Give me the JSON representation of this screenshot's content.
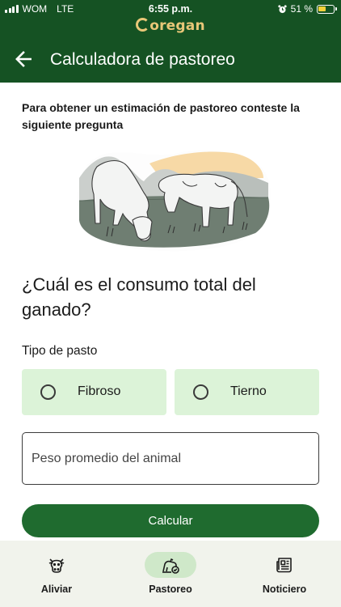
{
  "status_bar": {
    "carrier": "WOM",
    "network": "LTE",
    "time": "6:55 p.m.",
    "battery": "51 %",
    "battery_level": 0.51
  },
  "brand": {
    "logo_text": "oregan"
  },
  "header": {
    "title": "Calculadora de pastoreo"
  },
  "intro_text": "Para obtener un estimación de pastoreo conteste la siguiente pregunta",
  "question": "¿Cuál es el consumo total del ganado?",
  "pasture": {
    "label": "Tipo de pasto",
    "options": [
      "Fibroso",
      "Tierno"
    ]
  },
  "weight_field": {
    "placeholder": "Peso promedio del animal"
  },
  "calculate_button": "Calcular",
  "bottom_nav": {
    "items": [
      {
        "label": "Aliviar",
        "icon": "cow-icon"
      },
      {
        "label": "Pastoreo",
        "icon": "grazing-icon"
      },
      {
        "label": "Noticiero",
        "icon": "newspaper-icon"
      }
    ],
    "active": "Pastoreo"
  },
  "colors": {
    "header": "#155223",
    "button": "#1f6b2f",
    "option_bg": "#dcf3d8",
    "nav_bg": "#f1f3ec",
    "nav_active": "#cfe8c9"
  }
}
